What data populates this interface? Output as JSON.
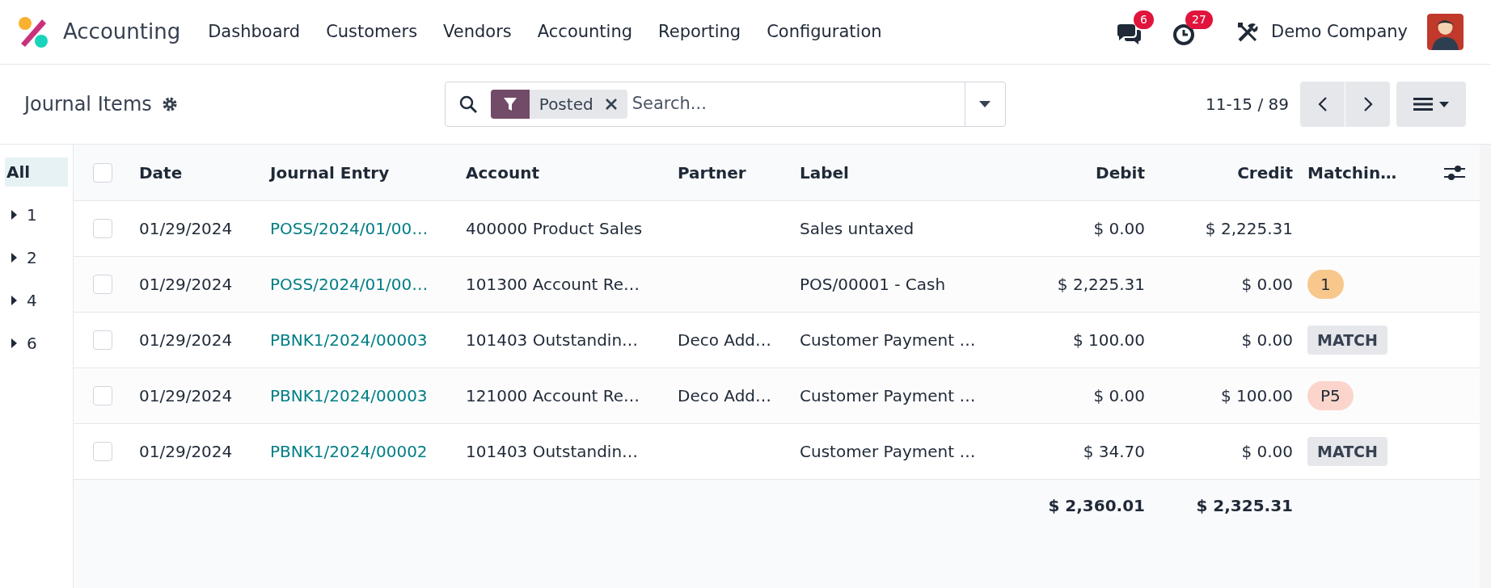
{
  "app": {
    "name": "Accounting"
  },
  "menu": [
    "Dashboard",
    "Customers",
    "Vendors",
    "Accounting",
    "Reporting",
    "Configuration"
  ],
  "systray": {
    "messages_count": "6",
    "activities_count": "27",
    "company": "Demo Company"
  },
  "control_panel": {
    "title": "Journal Items",
    "search": {
      "facets": [
        {
          "value": "Posted"
        }
      ],
      "placeholder": "Search..."
    },
    "pager": "11-15 / 89"
  },
  "sidebar": {
    "items": [
      {
        "label": "All",
        "selected": true,
        "kind": "all"
      },
      {
        "label": "1",
        "selected": false,
        "kind": "group"
      },
      {
        "label": "2",
        "selected": false,
        "kind": "group"
      },
      {
        "label": "4",
        "selected": false,
        "kind": "group"
      },
      {
        "label": "6",
        "selected": false,
        "kind": "group"
      }
    ]
  },
  "table": {
    "select_all_checked": false,
    "columns": [
      "Date",
      "Journal Entry",
      "Account",
      "Partner",
      "Label",
      "Debit",
      "Credit",
      "Matchin…"
    ],
    "rows": [
      {
        "checked": false,
        "date": "01/29/2024",
        "entry": "POSS/2024/01/00…",
        "account": "400000 Product Sales",
        "partner": "",
        "label": "Sales untaxed",
        "debit": "$ 0.00",
        "credit": "$ 2,225.31"
      },
      {
        "checked": false,
        "date": "01/29/2024",
        "entry": "POSS/2024/01/00…",
        "account": "101300 Account Re…",
        "partner": "",
        "label": "POS/00001 - Cash",
        "debit": "$ 2,225.31",
        "credit": "$ 0.00",
        "matching": {
          "kind": "badge",
          "text": "1",
          "color": "#f8c78c"
        }
      },
      {
        "checked": false,
        "date": "01/29/2024",
        "entry": "PBNK1/2024/00003",
        "account": "101403 Outstandin…",
        "partner": "Deco Add…",
        "label": "Customer Payment …",
        "debit": "$ 100.00",
        "credit": "$ 0.00",
        "matching": {
          "kind": "button",
          "text": "MATCH"
        }
      },
      {
        "checked": false,
        "date": "01/29/2024",
        "entry": "PBNK1/2024/00003",
        "account": "121000 Account Re…",
        "partner": "Deco Add…",
        "label": "Customer Payment …",
        "debit": "$ 0.00",
        "credit": "$ 100.00",
        "matching": {
          "kind": "badge",
          "text": "P5",
          "color": "#fbd5cb"
        }
      },
      {
        "checked": false,
        "date": "01/29/2024",
        "entry": "PBNK1/2024/00002",
        "account": "101403 Outstandin…",
        "partner": "",
        "label": "Customer Payment …",
        "debit": "$ 34.70",
        "credit": "$ 0.00",
        "matching": {
          "kind": "button",
          "text": "MATCH"
        }
      }
    ],
    "totals": {
      "debit": "$ 2,360.01",
      "credit": "$ 2,325.31"
    }
  }
}
